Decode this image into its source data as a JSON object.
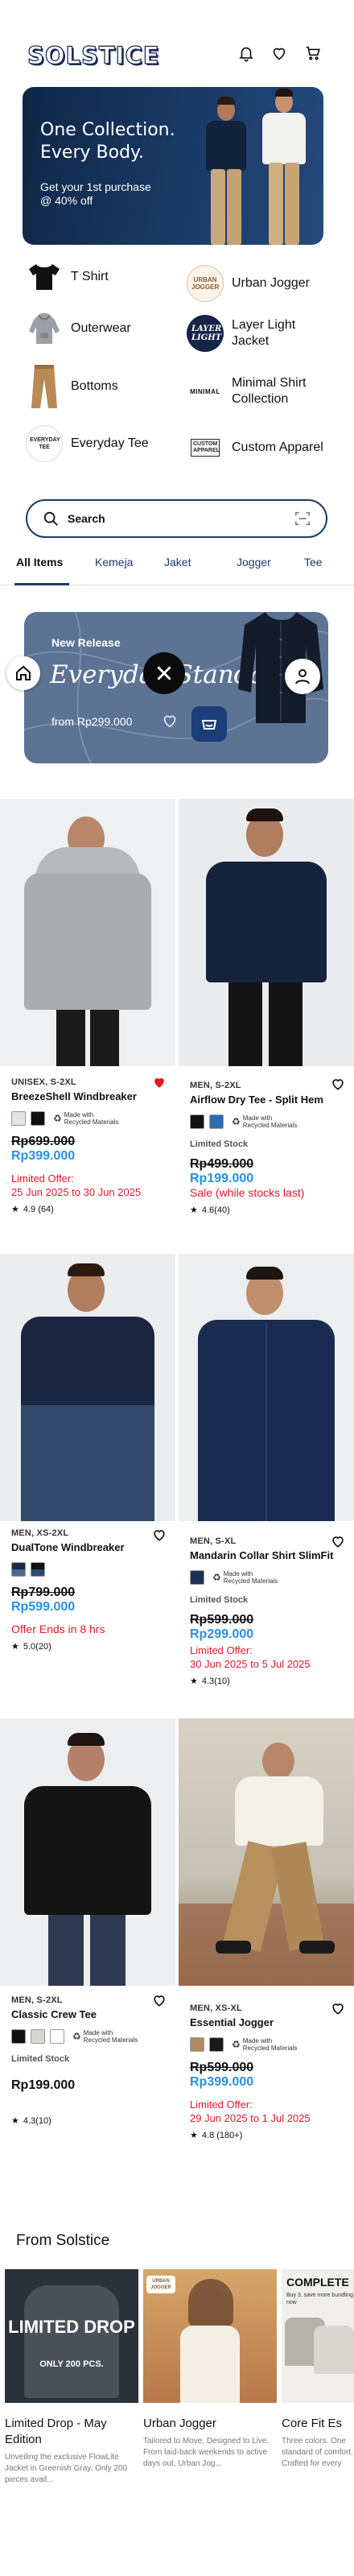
{
  "header": {
    "logo": "SOLSTICE",
    "icons": [
      "bell-icon",
      "heart-icon",
      "cart-icon"
    ]
  },
  "hero": {
    "title": "One Collection.\nEvery Body.",
    "subtitle": "Get your 1st purchase",
    "discount": "@ 40% off"
  },
  "categories": [
    {
      "label": "T Shirt",
      "icon": "tshirt-icon"
    },
    {
      "label": "Urban Jogger",
      "icon": "urban-jogger-logo",
      "logo_text": "URBAN JOGGER"
    },
    {
      "label": "Outerwear",
      "icon": "hoodie-icon"
    },
    {
      "label": "Layer Light Jacket",
      "icon": "layer-light-logo",
      "logo_text": "LAYER LIGHT"
    },
    {
      "label": "Bottoms",
      "icon": "pants-icon"
    },
    {
      "label": "Minimal Shirt Collection",
      "icon": "minimal-logo",
      "logo_text": "MINIMAL"
    },
    {
      "label": "Everyday Tee",
      "icon": "everyday-tee-logo",
      "logo_text": "EVERYDAY TEE"
    },
    {
      "label": "Custom Apparel",
      "icon": "custom-apparel-logo",
      "logo_text": "CUSTOM APPAREL"
    }
  ],
  "search": {
    "placeholder": "Search"
  },
  "tabs": [
    "All Items",
    "Kemeja",
    "Jaket",
    "Jogger",
    "Tee"
  ],
  "banner": {
    "label": "New Release",
    "title": "Everyday Standard",
    "price": "from Rp299.000"
  },
  "products": [
    {
      "tag": "UNISEX, S-2XL",
      "name": "BreezeShell Windbreaker",
      "eco": "Made with Recycled Materials",
      "old_price": "Rp699.000",
      "new_price": "Rp399.000",
      "offer_label": "Limited Offer:",
      "offer_date": "25 Jun 2025 to 30 Jun 2025",
      "rating": "4.9 (64)",
      "favorited": true,
      "colors": [
        "#e6e3dc",
        "#111111"
      ]
    },
    {
      "tag": "MEN, S-2XL",
      "name": "Airflow Dry Tee - Split Hem",
      "eco": "Made with Recycled Materials",
      "stock": "Limited Stock",
      "old_price": "Rp499.000",
      "new_price": "Rp199.000",
      "offer_label": "Sale (while stocks last)",
      "rating": "4.6(40)",
      "favorited": false,
      "colors": [
        "#111111",
        "#2e6cb5"
      ]
    },
    {
      "tag": "MEN, XS-2XL",
      "name": "DualTone Windbreaker",
      "old_price": "Rp799.000",
      "new_price": "Rp599.000",
      "offer_label": "Offer Ends in 8 hrs",
      "rating": "5.0(20)",
      "favorited": false,
      "colors": [
        "#1c2a44",
        "#2b4a6e"
      ]
    },
    {
      "tag": "MEN, S-XL",
      "name": "Mandarin Collar Shirt SlimFit",
      "eco": "Made with Recycled Materials",
      "stock": "Limited Stock",
      "old_price": "Rp599.000",
      "new_price": "Rp299.000",
      "offer_label": "Limited Offer:",
      "offer_date": "30 Jun 2025 to 5 Jul 2025",
      "rating": "4.3(10)",
      "favorited": false,
      "colors": [
        "#1f2f55"
      ]
    },
    {
      "tag": "MEN, S-2XL",
      "name": "Classic Crew Tee",
      "eco": "Made with Recycled Materials",
      "stock": "Limited Stock",
      "price": "Rp199.000",
      "rating": "4.3(10)",
      "favorited": false,
      "colors": [
        "#111111",
        "#d9d5cf",
        "#ffffff"
      ]
    },
    {
      "tag": "MEN, XS-XL",
      "name": "Essential Jogger",
      "eco": "Made with Recycled Materials",
      "old_price": "Rp599.000",
      "new_price": "Rp399.000",
      "offer_label": "Limited Offer:",
      "offer_date": "29 Jun 2025 to 1 Jul 2025",
      "rating": "4.8 (180+)",
      "favorited": false,
      "colors": [
        "#b08a62",
        "#1a1a1a"
      ]
    }
  ],
  "from_solstice": {
    "title": "From Solstice",
    "cards": [
      {
        "title": "Limited Drop - May Edition",
        "desc": "Unveiling the exclusive FlowLite Jacket in Greenish Gray. Only 200 pieces avail...",
        "img_text": "LIMITED DROP",
        "img_sub": "ONLY 200 PCS."
      },
      {
        "title": "Urban Jogger",
        "desc": "Tailored to Move, Designed to Live. From laid-back weekends to active days out, Urban Jog...",
        "img_text": "URBAN JOGGER"
      },
      {
        "title": "Core Fit Es",
        "desc": "Three colors. One standard of comfort. Crafted for every",
        "img_text": "COMPLETE",
        "img_sub": "Buy 3, save more bundling now"
      }
    ]
  }
}
